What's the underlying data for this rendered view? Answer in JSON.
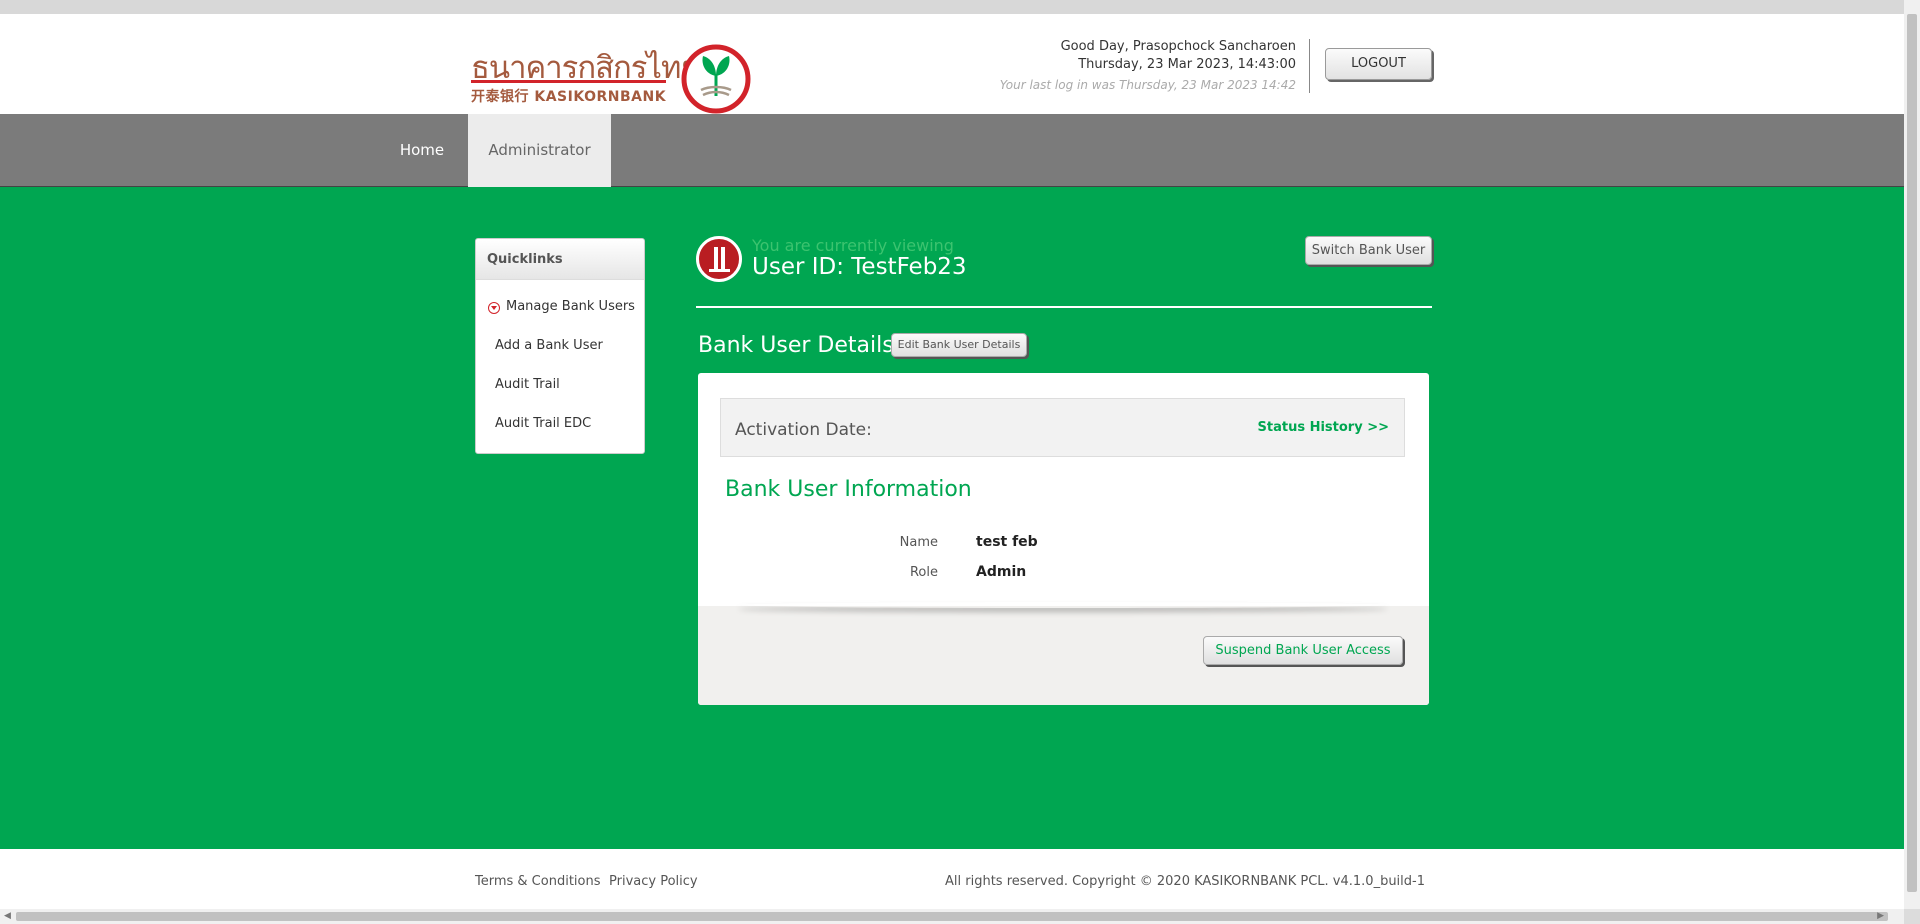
{
  "brand": {
    "thai_name": "ธนาคารกสิกรไทย",
    "english_name": "开泰银行 KASIKORNBANK",
    "logo_color": "#d2232a",
    "brand_green": "#00a651"
  },
  "header": {
    "greeting": "Good Day, Prasopchock Sancharoen",
    "datetime": "Thursday, 23 Mar 2023, 14:43:00",
    "last_login": "Your last log in was Thursday, 23 Mar 2023 14:42",
    "logout_label": "LOGOUT"
  },
  "nav": {
    "home": "Home",
    "administrator": "Administrator"
  },
  "quicklinks": {
    "title": "Quicklinks",
    "items": [
      "Manage Bank Users",
      "Add a Bank User",
      "Audit Trail",
      "Audit Trail EDC"
    ]
  },
  "viewing": {
    "label": "You are currently viewing",
    "user_id": "User ID: TestFeb23",
    "switch_label": "Switch Bank User"
  },
  "details": {
    "title": "Bank User Details",
    "edit_label": "Edit Bank User Details",
    "activation_label": "Activation Date:",
    "status_history": "Status History >>",
    "info_title": "Bank User Information",
    "fields": [
      {
        "label": "Name",
        "value": "test feb"
      },
      {
        "label": "Role",
        "value": "Admin"
      }
    ],
    "suspend_label": "Suspend Bank User Access"
  },
  "footer": {
    "terms": "Terms & Conditions",
    "privacy": "Privacy Policy",
    "copyright": "All rights reserved. Copyright © 2020 KASIKORNBANK PCL.  v4.1.0_build-1"
  }
}
